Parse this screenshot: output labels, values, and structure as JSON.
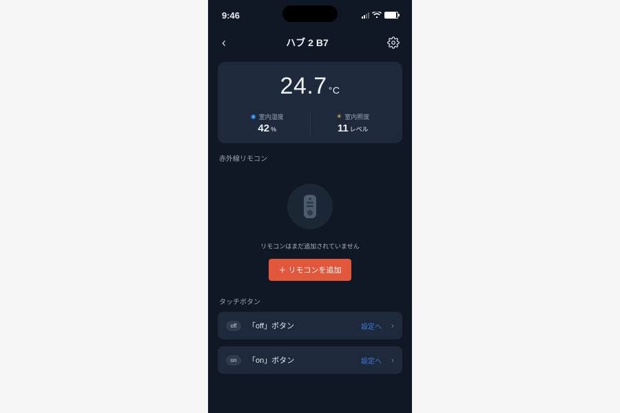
{
  "status": {
    "time": "9:46"
  },
  "nav": {
    "title": "ハブ 2 B7"
  },
  "climate": {
    "temp_value": "24.7",
    "temp_unit": "°C",
    "humidity": {
      "label": "室内湿度",
      "value": "42",
      "unit": "%"
    },
    "light": {
      "label": "室内照度",
      "value": "11",
      "unit": "レベル"
    }
  },
  "ir": {
    "heading": "赤外線リモコン",
    "empty_text": "リモコンはまだ追加されていません",
    "add_label": "＋ リモコンを追加"
  },
  "touch": {
    "heading": "タッチボタン",
    "link_label": "設定へ",
    "items": [
      {
        "badge": "off",
        "label": "「off」ボタン"
      },
      {
        "badge": "on",
        "label": "「on」ボタン"
      }
    ]
  }
}
